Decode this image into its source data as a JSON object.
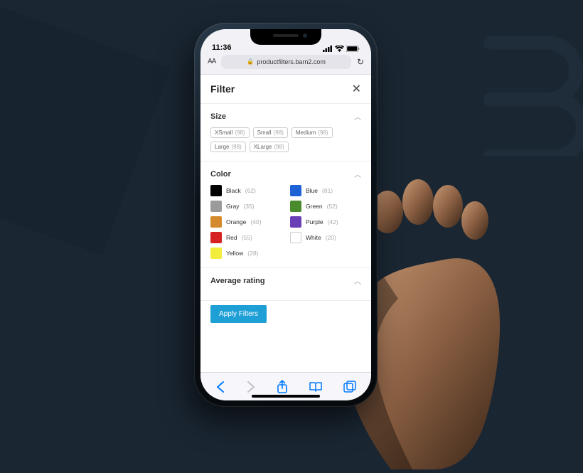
{
  "status": {
    "time": "11:36",
    "signal_icon": "cellular-signal-icon",
    "wifi_icon": "wifi-icon",
    "battery_icon": "battery-icon"
  },
  "browser": {
    "aa_label": "AA",
    "lock_icon": "lock-icon",
    "url": "productfilters.barn2.com",
    "reload_icon": "reload-icon"
  },
  "filter": {
    "title": "Filter",
    "close_icon": "close-icon",
    "sections": {
      "size": {
        "title": "Size",
        "chevron": "chevron-up-icon",
        "options": [
          {
            "label": "XSmall",
            "count": "(98)"
          },
          {
            "label": "Small",
            "count": "(98)"
          },
          {
            "label": "Medium",
            "count": "(98)"
          },
          {
            "label": "Large",
            "count": "(98)"
          },
          {
            "label": "XLarge",
            "count": "(98)"
          }
        ]
      },
      "color": {
        "title": "Color",
        "chevron": "chevron-up-icon",
        "options": [
          {
            "label": "Black",
            "count": "(62)",
            "hex": "#000000"
          },
          {
            "label": "Blue",
            "count": "(81)",
            "hex": "#1e63d6"
          },
          {
            "label": "Gray",
            "count": "(35)",
            "hex": "#9b9b9b"
          },
          {
            "label": "Green",
            "count": "(52)",
            "hex": "#4a8b2e"
          },
          {
            "label": "Orange",
            "count": "(40)",
            "hex": "#d68a2e"
          },
          {
            "label": "Purple",
            "count": "(42)",
            "hex": "#6a3fb5"
          },
          {
            "label": "Red",
            "count": "(55)",
            "hex": "#d62222"
          },
          {
            "label": "White",
            "count": "(20)",
            "hex": "#ffffff"
          },
          {
            "label": "Yellow",
            "count": "(28)",
            "hex": "#f2ec3d"
          }
        ]
      },
      "rating": {
        "title": "Average rating",
        "chevron": "chevron-up-icon"
      }
    },
    "apply_label": "Apply Filters"
  },
  "toolbar": {
    "back_icon": "back-icon",
    "forward_icon": "forward-icon",
    "share_icon": "share-icon",
    "bookmarks_icon": "bookmarks-icon",
    "tabs_icon": "tabs-icon"
  },
  "colors": {
    "accent": "#1e9fd6",
    "ios_blue": "#007aff"
  }
}
